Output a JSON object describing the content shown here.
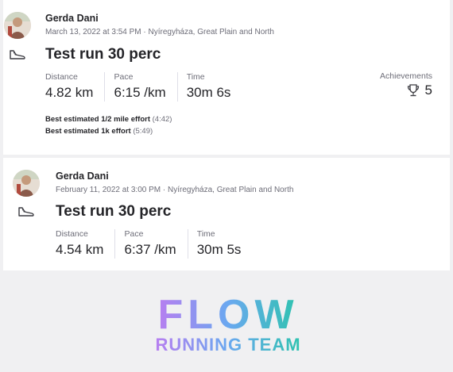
{
  "activities": [
    {
      "athlete": "Gerda Dani",
      "meta": "March 13, 2022 at 3:54 PM · Nyíregyháza, Great Plain and North",
      "sport_icon": "running-shoe-icon",
      "title": "Test run 30 perc",
      "stats": [
        {
          "label": "Distance",
          "value": "4.82 km"
        },
        {
          "label": "Pace",
          "value": "6:15 /km"
        },
        {
          "label": "Time",
          "value": "30m 6s"
        }
      ],
      "achievements": {
        "label": "Achievements",
        "icon": "trophy-icon",
        "count": "5"
      },
      "efforts": [
        {
          "label": "Best estimated 1/2 mile effort",
          "value": "(4:42)"
        },
        {
          "label": "Best estimated 1k effort",
          "value": "(5:49)"
        }
      ]
    },
    {
      "athlete": "Gerda Dani",
      "meta": "February 11, 2022 at 3:00 PM · Nyíregyháza, Great Plain and North",
      "sport_icon": "running-shoe-icon",
      "title": "Test run 30 perc",
      "stats": [
        {
          "label": "Distance",
          "value": "4.54 km"
        },
        {
          "label": "Pace",
          "value": "6:37 /km"
        },
        {
          "label": "Time",
          "value": "30m 5s"
        }
      ]
    }
  ],
  "logo": {
    "line1": "FLOW",
    "line2": "RUNNING TEAM",
    "colors": {
      "purple": "#b77ef0",
      "blue": "#6aa8f0",
      "teal": "#2fc3b0"
    }
  }
}
